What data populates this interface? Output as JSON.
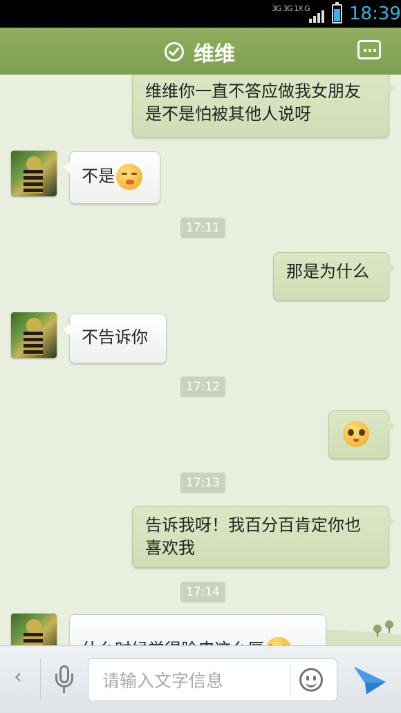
{
  "status_bar": {
    "network_label": "3G 3G 1X G",
    "time": "18:39",
    "accent_color": "#33b5e5"
  },
  "header": {
    "title": "维维",
    "verified_icon": "check-circle-icon",
    "menu_icon": "more-dots-icon",
    "bar_color": "#8aaa5a"
  },
  "messages": [
    {
      "side": "me",
      "text": "维维你一直不答应做我女朋友是不是怕被其他人说呀"
    },
    {
      "side": "other",
      "text": "不是",
      "emoji": "shush-face-emoji"
    },
    {
      "type": "time",
      "text": "17:11"
    },
    {
      "side": "me",
      "text": "那是为什么"
    },
    {
      "side": "other",
      "text": "不告诉你"
    },
    {
      "type": "time",
      "text": "17:12"
    },
    {
      "side": "me",
      "text": "",
      "emoji": "pleading-face-emoji"
    },
    {
      "type": "time",
      "text": "17:13"
    },
    {
      "side": "me",
      "text": "告诉我呀！我百分百肯定你也喜欢我"
    },
    {
      "type": "time",
      "text": "17:14"
    },
    {
      "side": "other",
      "text": "什么时候觉得脸皮这么厚",
      "emoji": "annoyed-face-emoji"
    }
  ],
  "composer": {
    "placeholder": "请输入文字信息",
    "back_icon": "chevron-left-icon",
    "voice_icon": "microphone-icon",
    "emoji_icon": "smiley-icon",
    "send_icon": "send-arrow-icon",
    "send_color": "#2a7fd0"
  }
}
